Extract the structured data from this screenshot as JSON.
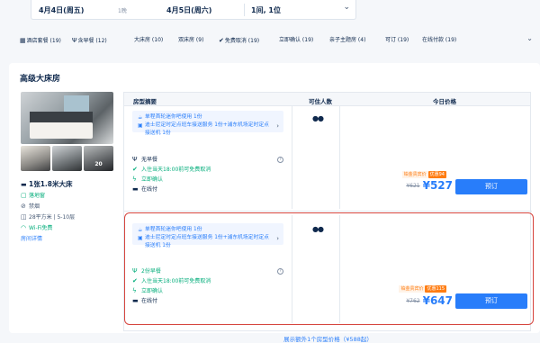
{
  "search": {
    "checkin": "4月4日(周五)",
    "nights": "1晚",
    "checkout": "4月5日(周六)",
    "rooms_guests": "1间, 1位",
    "dropdown_icon": "chevron-down-icon"
  },
  "filters": [
    {
      "label": "酒店套餐 (19)",
      "icon": "package-icon"
    },
    {
      "label": "含早餐 (12)",
      "icon": "breakfast-icon"
    },
    {
      "label": "大床房 (10)"
    },
    {
      "label": "双床房 (9)"
    },
    {
      "label": "免费取消 (19)",
      "icon": "check-circle-icon"
    },
    {
      "label": "立即确认 (19)"
    },
    {
      "label": "亲子主题房 (4)"
    },
    {
      "label": "可订 (19)"
    },
    {
      "label": "在线付款 (19)"
    }
  ],
  "room": {
    "title": "高级大床房",
    "photo_count": "20",
    "bed": "1张1.8米大床",
    "window": "落地窗",
    "smoking": "禁烟",
    "area_floor": "28平方米 | 5-10层",
    "wifi": "Wi-Fi免费",
    "details_link": "房间详情"
  },
  "table": {
    "headers": [
      "房型摘要",
      "可住人数",
      "今日价格"
    ],
    "rows": [
      {
        "package": [
          "单程首轮迷你吧使用 1份",
          "迪士尼定时定点班车接送服务 1份+浦东机场定时定点接送机 1份"
        ],
        "meal": "无早餐",
        "cancel": "入住当天18:00前可免费取消",
        "confirm": "立即确认",
        "payment": "在线付",
        "occupancy": "2",
        "tag_label": "铂金贵宾价",
        "tag_discount": "优惠94",
        "old_price": "¥621",
        "price": "¥527",
        "book": "预订"
      },
      {
        "package": [
          "单程首轮迷你吧使用 1份",
          "迪士尼定时定点班车接送服务 1份+浦东机场定时定点接送机 1份"
        ],
        "meal": "2份早餐",
        "cancel": "入住当天18:00前可免费取消",
        "confirm": "立即确认",
        "payment": "在线付",
        "occupancy": "2",
        "tag_label": "铂金贵宾价",
        "tag_discount": "优惠115",
        "old_price": "¥762",
        "price": "¥647",
        "book": "预订"
      }
    ],
    "more": "展示额外1个房型价格（¥588起）"
  },
  "colors": {
    "accent": "#287dfa",
    "highlight": "#d6453e",
    "green": "#06ae7c",
    "orange": "#ff7d13"
  }
}
